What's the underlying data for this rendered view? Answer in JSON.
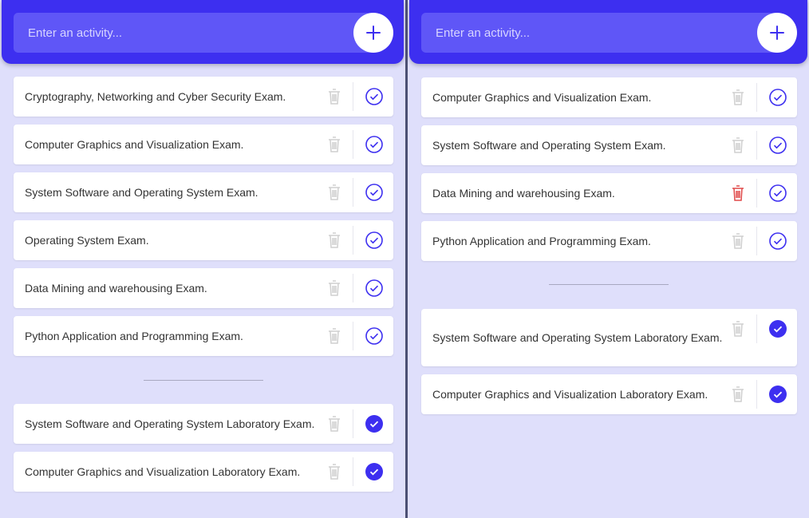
{
  "placeholder": "Enter an activity...",
  "colors": {
    "accent": "#3d2ff0",
    "trash_default": "#cfcfcf",
    "trash_hover": "#e04848",
    "panel_bg": "#dfdffb"
  },
  "left": {
    "todo": [
      "Cryptography, Networking and Cyber Security Exam.",
      "Computer Graphics and Visualization Exam.",
      "System Software and Operating System Exam.",
      "Operating System Exam.",
      "Data Mining and warehousing Exam.",
      "Python Application and Programming Exam."
    ],
    "done": [
      "System Software and Operating System Laboratory Exam.",
      "Computer Graphics and Visualization Laboratory Exam."
    ]
  },
  "right": {
    "todo": [
      "Computer Graphics and Visualization Exam.",
      "System Software and Operating System Exam.",
      "Data Mining and warehousing Exam.",
      "Python Application and Programming Exam."
    ],
    "done": [
      "System Software and Operating System Laboratory Exam.",
      "Computer Graphics and Visualization Laboratory Exam."
    ]
  }
}
